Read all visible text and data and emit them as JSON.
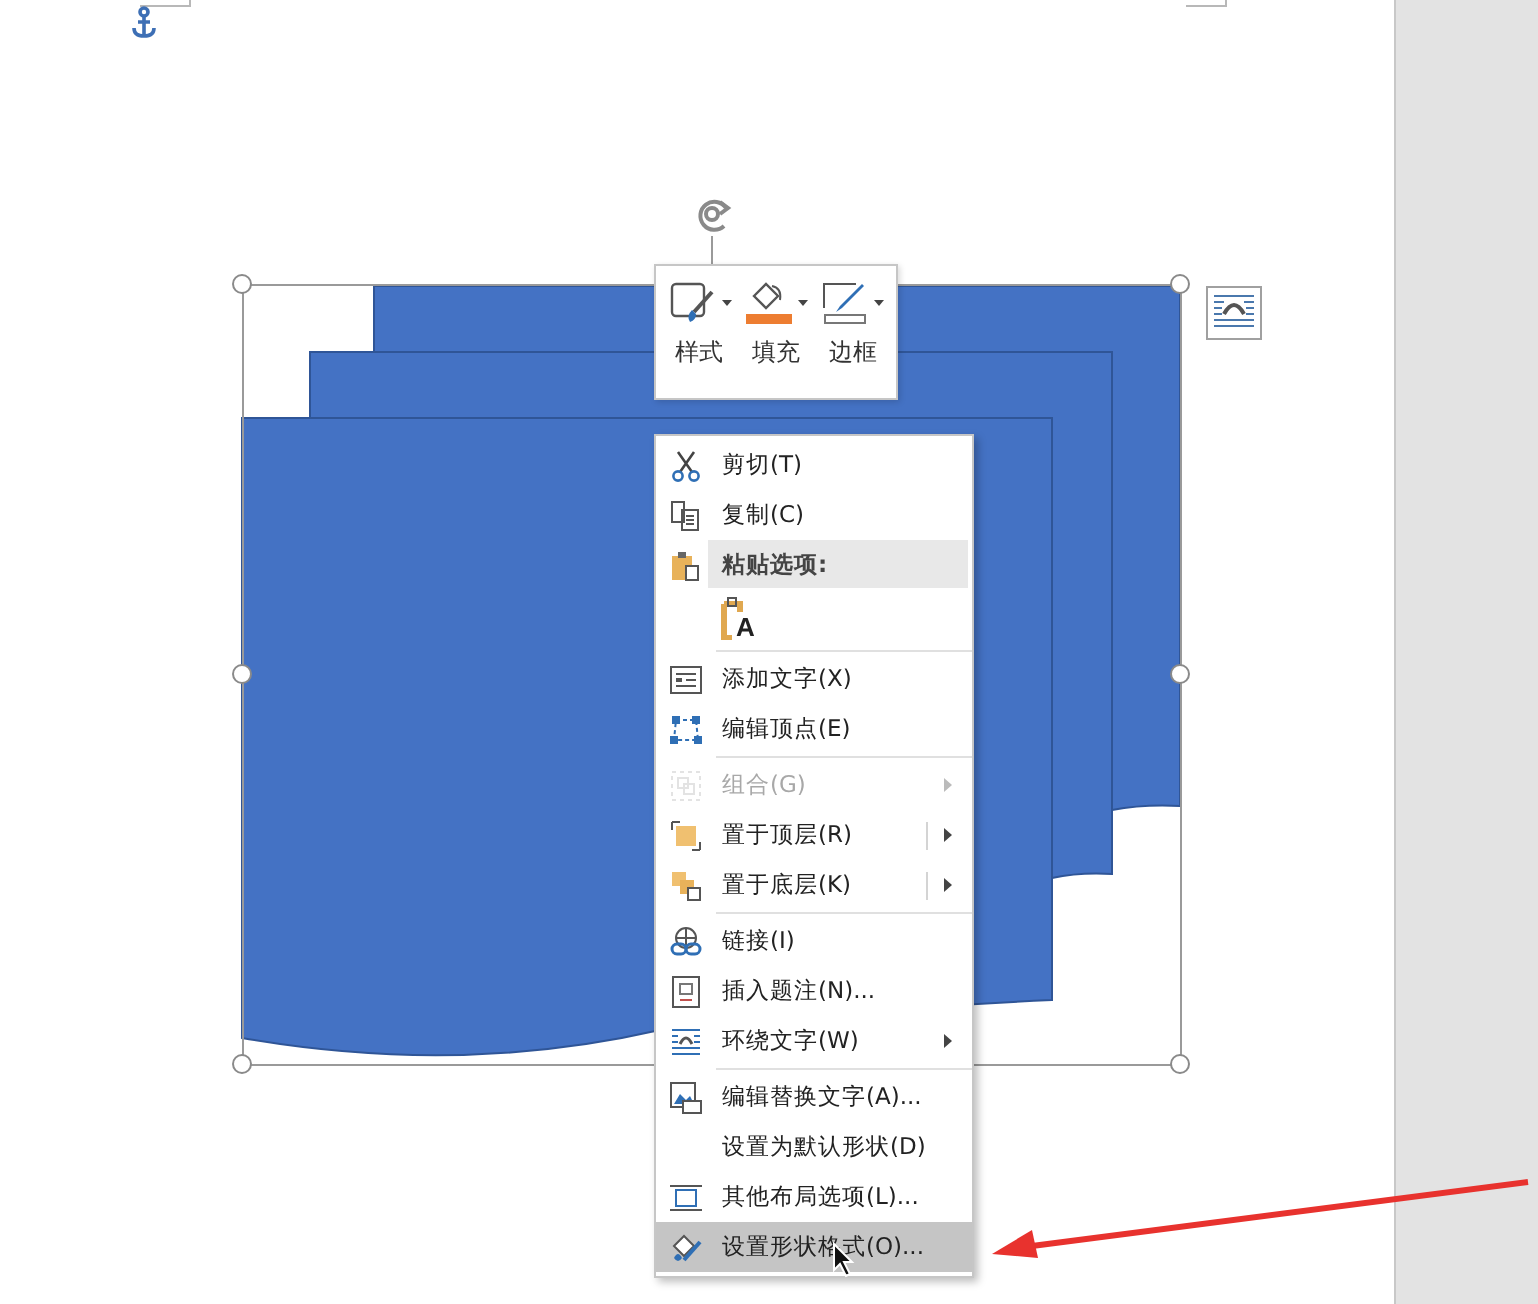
{
  "mini_toolbar": {
    "buttons": [
      {
        "label": "样式"
      },
      {
        "label": "填充"
      },
      {
        "label": "边框"
      }
    ]
  },
  "context_menu": {
    "groups": [
      {
        "items": [
          {
            "kind": "command",
            "label": "剪切(T)",
            "disabled": false,
            "submenu": false,
            "split": false,
            "selected": false
          },
          {
            "kind": "command",
            "label": "复制(C)",
            "disabled": false,
            "submenu": false,
            "split": false,
            "selected": false
          },
          {
            "kind": "header",
            "label": "粘贴选项:"
          },
          {
            "kind": "paste-option",
            "glyph": "A",
            "selected": false
          }
        ]
      },
      {
        "items": [
          {
            "kind": "command",
            "label": "添加文字(X)",
            "disabled": false,
            "submenu": false,
            "split": false,
            "selected": false
          },
          {
            "kind": "command",
            "label": "编辑顶点(E)",
            "disabled": false,
            "submenu": false,
            "split": false,
            "selected": false
          }
        ]
      },
      {
        "items": [
          {
            "kind": "command",
            "label": "组合(G)",
            "disabled": true,
            "submenu": true,
            "split": false,
            "selected": false
          },
          {
            "kind": "command",
            "label": "置于顶层(R)",
            "disabled": false,
            "submenu": true,
            "split": true,
            "selected": false
          },
          {
            "kind": "command",
            "label": "置于底层(K)",
            "disabled": false,
            "submenu": true,
            "split": true,
            "selected": false
          }
        ]
      },
      {
        "items": [
          {
            "kind": "command",
            "label": "链接(I)",
            "disabled": false,
            "submenu": false,
            "split": false,
            "selected": false
          },
          {
            "kind": "command",
            "label": "插入题注(N)...",
            "disabled": false,
            "submenu": false,
            "split": false,
            "selected": false
          },
          {
            "kind": "command",
            "label": "环绕文字(W)",
            "disabled": false,
            "submenu": true,
            "split": false,
            "selected": false
          }
        ]
      },
      {
        "items": [
          {
            "kind": "command",
            "label": "编辑替换文字(A)...",
            "disabled": false,
            "submenu": false,
            "split": false,
            "selected": false
          },
          {
            "kind": "command",
            "label": "设置为默认形状(D)",
            "disabled": false,
            "submenu": false,
            "split": false,
            "selected": false
          },
          {
            "kind": "command",
            "label": "其他布局选项(L)...",
            "disabled": false,
            "submenu": false,
            "split": false,
            "selected": false
          },
          {
            "kind": "command",
            "label": "设置形状格式(O)...",
            "disabled": false,
            "submenu": false,
            "split": false,
            "selected": true
          }
        ]
      }
    ]
  }
}
